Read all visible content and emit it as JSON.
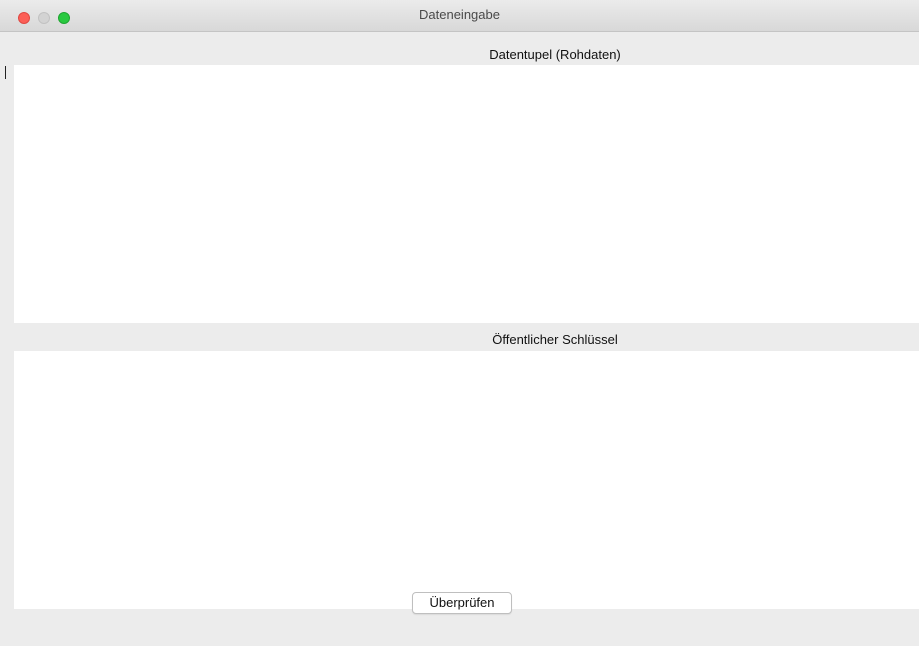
{
  "window": {
    "title": "Dateneingabe"
  },
  "sections": {
    "raw_data": {
      "label": "Datentupel (Rohdaten)",
      "value": ""
    },
    "public_key": {
      "label": "Öffentlicher Schlüssel",
      "value": ""
    }
  },
  "actions": {
    "verify_label": "Überprüfen"
  },
  "colors": {
    "close": "#fc5f57",
    "minimize_inactive": "#d3d3d3",
    "zoom": "#29c940"
  }
}
